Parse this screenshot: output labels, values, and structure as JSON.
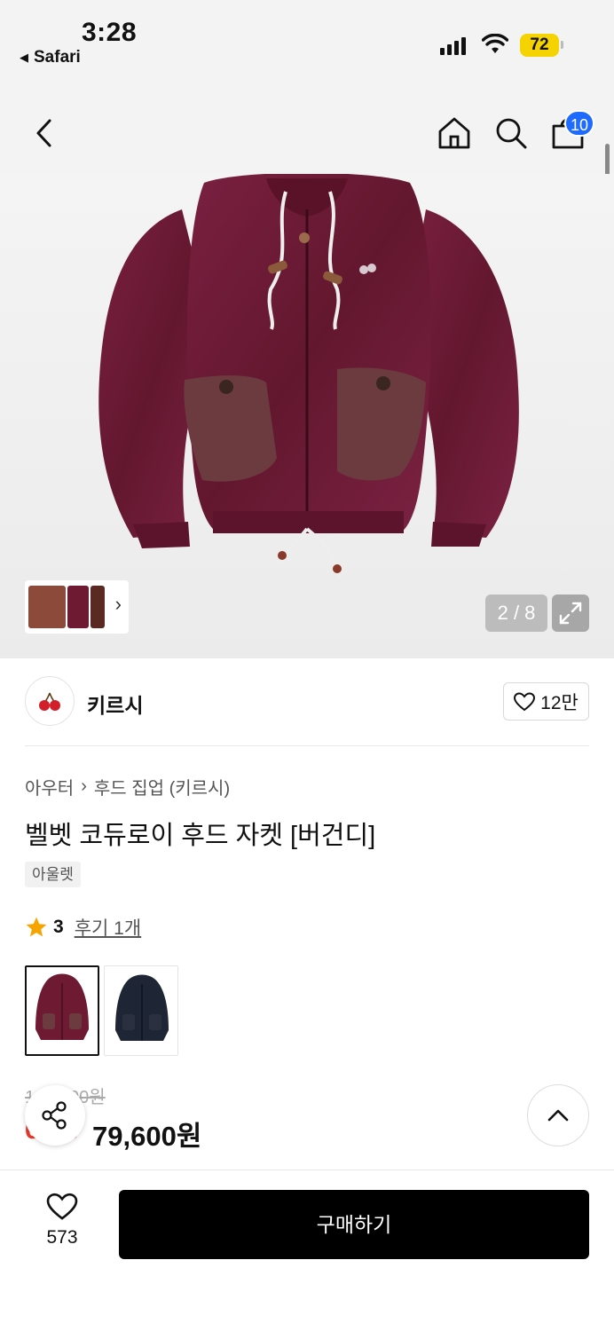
{
  "status_bar": {
    "time": "3:28",
    "back_app": "Safari",
    "battery": "72"
  },
  "nav": {
    "cart_count": "10"
  },
  "gallery": {
    "counter": "2 / 8"
  },
  "brand": {
    "name": "키르시",
    "likes": "12만"
  },
  "breadcrumb": [
    "아우터",
    "후드 집업 (키르시)"
  ],
  "product": {
    "title": "벨벳 코듀로이 후드 자켓 [버건디]",
    "tag": "아울렛",
    "rating": "3",
    "review_text": "후기 1개",
    "original_price": "199,000원",
    "discount": "60%",
    "price": "79,600원"
  },
  "bottom": {
    "wish_count": "573",
    "buy_label": "구매하기"
  },
  "colors": {
    "accent_blue": "#1f6bff",
    "discount_red": "#f0362b",
    "star": "#f5a400",
    "jacket": "#6e1a33"
  }
}
